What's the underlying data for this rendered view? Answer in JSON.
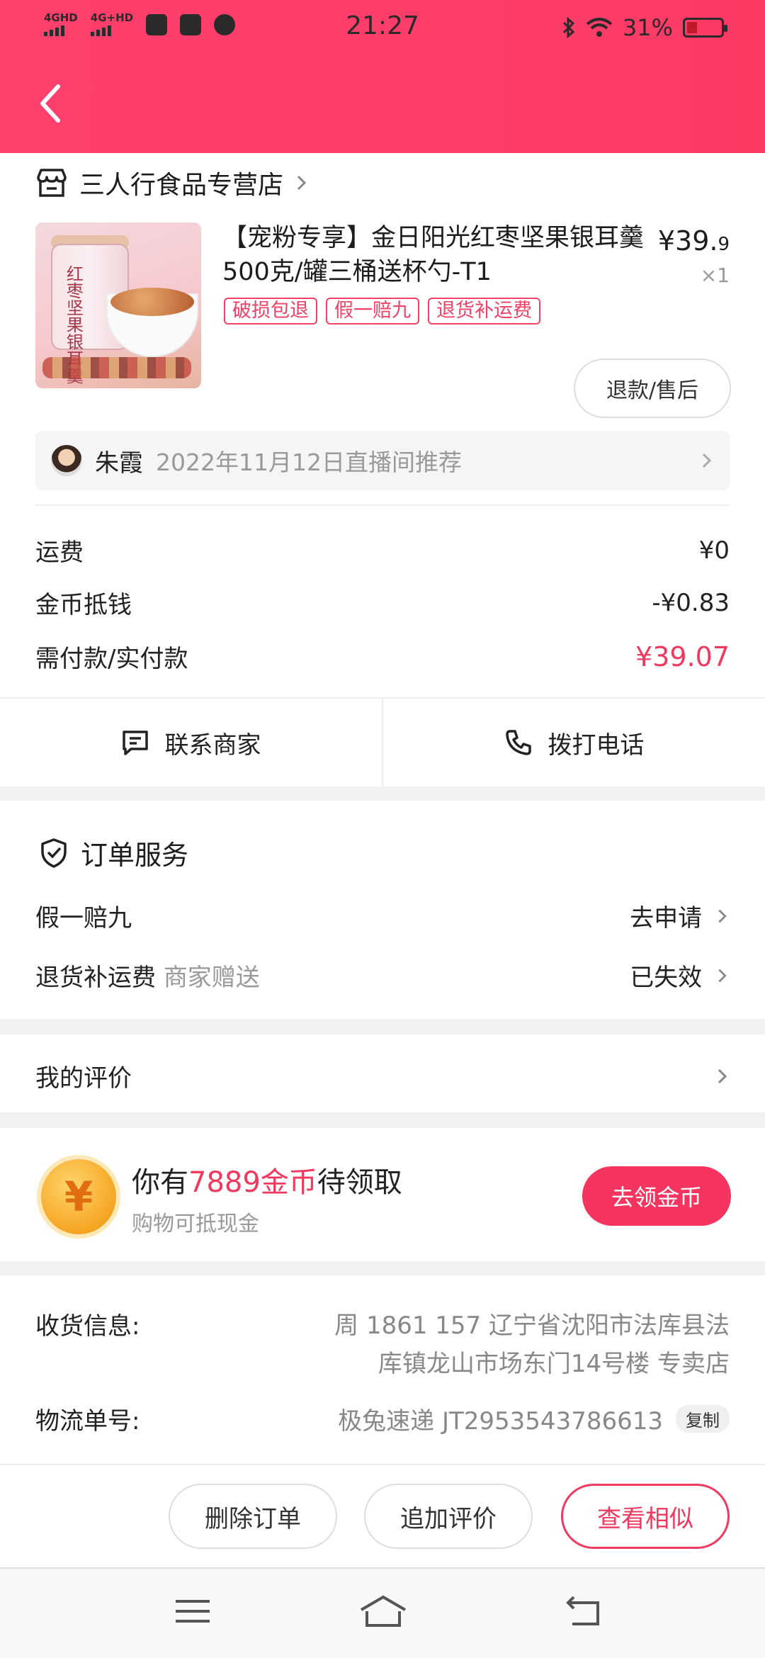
{
  "status_bar": {
    "network1": "4GHD",
    "network2": "4G+HD",
    "time": "21:27",
    "battery": "31%",
    "battery_level": 0.31
  },
  "shop": {
    "name": "三人行食品专营店"
  },
  "product": {
    "title": "【宠粉专享】金日阳光红枣坚果银耳羹500克/罐三桶送杯勺-T1",
    "image_label": "红枣坚果银耳羹",
    "price_main": "¥39.",
    "price_small": "9",
    "quantity": "×1",
    "tags": [
      "破损包退",
      "假一赔九",
      "退货补运费"
    ],
    "refund_label": "退款/售后"
  },
  "recommendation": {
    "name": "朱霞",
    "text": "2022年11月12日直播间推荐"
  },
  "fees": [
    {
      "label": "运费",
      "value": "¥0"
    },
    {
      "label": "金币抵钱",
      "value": "-¥0.83"
    },
    {
      "label": "需付款/实付款",
      "value": "¥39.07"
    }
  ],
  "actions": {
    "contact": "联系商家",
    "call": "拨打电话"
  },
  "service": {
    "title": "订单服务",
    "items": [
      {
        "label": "假一赔九",
        "note": "",
        "value": "去申请"
      },
      {
        "label": "退货补运费",
        "note": "商家赠送",
        "value": "已失效"
      }
    ]
  },
  "review": {
    "label": "我的评价"
  },
  "coins": {
    "prefix": "你有",
    "amount": "7889金币",
    "suffix": "待领取",
    "sub": "购物可抵现金",
    "button": "去领金币",
    "icon_glyph": "¥"
  },
  "shipping": {
    "address_label": "收货信息:",
    "address_line1": "周  1861  157 辽宁省沈阳市法库县法",
    "address_line2": "库镇龙山市场东门14号楼    专卖店",
    "tracking_label": "物流单号:",
    "tracking_value": "极兔速递 JT2953543786613",
    "copy_label": "复制"
  },
  "bottom_buttons": {
    "delete": "删除订单",
    "add_review": "追加评价",
    "similar": "查看相似"
  },
  "colors": {
    "header": "#ff3f6c",
    "accent": "#f0395f"
  }
}
